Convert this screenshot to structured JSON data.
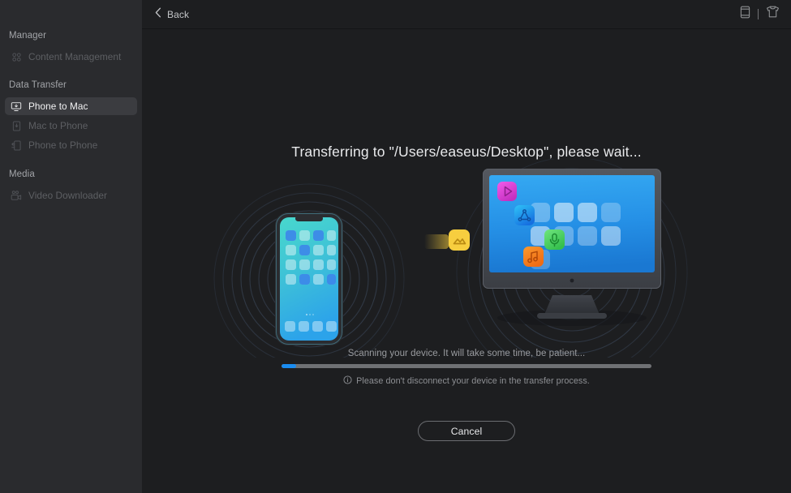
{
  "window": {
    "bg_main": "#1d1e20",
    "bg_sidebar": "#2a2b2e",
    "accent": "#1a8cf0"
  },
  "sidebar": {
    "sections": [
      {
        "label": "Manager",
        "items": [
          {
            "label": "Content Management",
            "icon": "grid-apps-icon",
            "state": "disabled"
          }
        ]
      },
      {
        "label": "Data Transfer",
        "items": [
          {
            "label": "Phone to Mac",
            "icon": "phone-to-mac-icon",
            "state": "selected"
          },
          {
            "label": "Mac to Phone",
            "icon": "mac-to-phone-icon",
            "state": "disabled"
          },
          {
            "label": "Phone to Phone",
            "icon": "phone-to-phone-icon",
            "state": "disabled"
          }
        ]
      },
      {
        "label": "Media",
        "items": [
          {
            "label": "Video Downloader",
            "icon": "video-camera-icon",
            "state": "disabled"
          }
        ]
      }
    ]
  },
  "topbar": {
    "back_label": "Back",
    "back_icon": "chevron-left-icon",
    "right_icons": [
      {
        "name": "device-phone-icon"
      },
      {
        "name": "divider"
      },
      {
        "name": "tshirt-skin-icon"
      }
    ]
  },
  "main": {
    "headline": "Transferring to \"/Users/easeus/Desktop\", please wait...",
    "scan_status": "Scanning your device. It will take some time, be patient...",
    "hint_icon": "info-circle-icon",
    "hint_text": "Please don't disconnect your device in the transfer process.",
    "progress_percent": 4,
    "cancel_label": "Cancel"
  },
  "illustration": {
    "phone": {
      "name": "source-phone-device",
      "screen_gradient_top": "#44d2ce",
      "screen_gradient_bottom": "#2fa5e8",
      "body_color": "#2e3034"
    },
    "monitor": {
      "name": "target-mac-device",
      "screen_gradient_top": "#2e9ff0",
      "screen_gradient_bottom": "#1e7fd8",
      "bezel_color": "#4a4d54",
      "app_icons": [
        {
          "name": "video-play-app-icon",
          "color": "#e040d8"
        },
        {
          "name": "network-share-app-icon",
          "color": "#18a8f0"
        },
        {
          "name": "microphone-app-icon",
          "color": "#4fd164"
        },
        {
          "name": "music-note-app-icon",
          "color": "#f58220"
        }
      ]
    },
    "transfer_packet": {
      "name": "photo-transfer-packet-icon",
      "color": "#f7ce3f"
    },
    "ring_color": "#2f3641"
  }
}
